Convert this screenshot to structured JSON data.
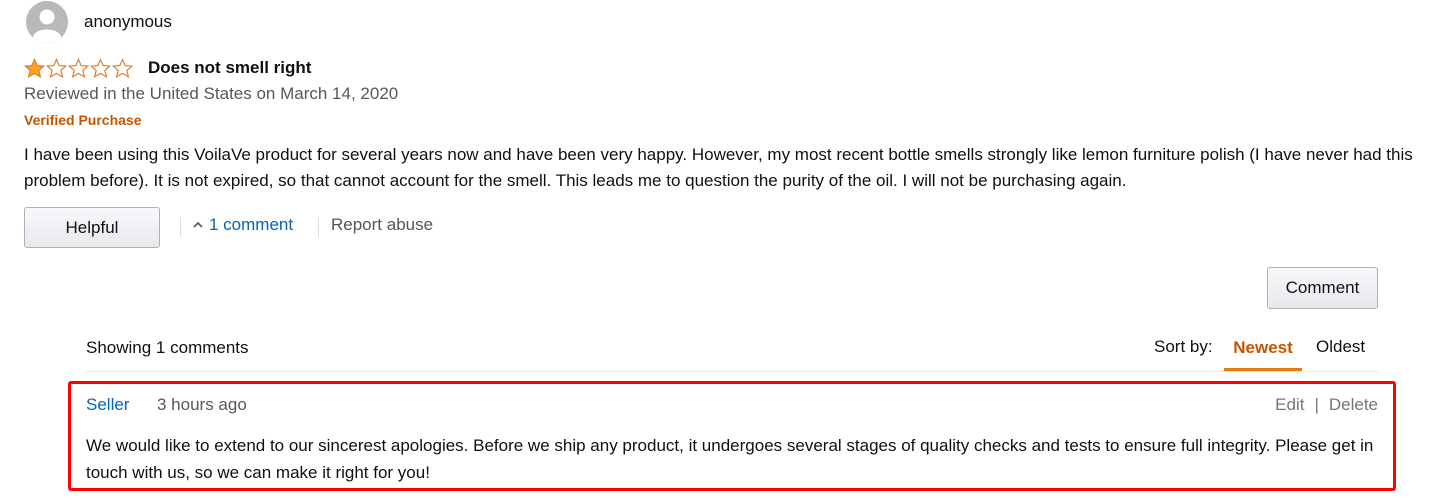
{
  "review": {
    "profile_name": "anonymous",
    "rating": 1,
    "rating_max": 5,
    "title": "Does not smell right",
    "date_line": "Reviewed in the United States on March 14, 2020",
    "verified_label": "Verified Purchase",
    "body": "I have been using this VoilaVe product for several years now and have been very happy. However, my most recent bottle smells strongly like lemon furniture polish (I have never had this problem before). It is not expired, so that cannot account for the smell. This leads me to question the purity of the oil. I will not be purchasing again."
  },
  "actions": {
    "helpful_label": "Helpful",
    "comments_link_label": "1 comment",
    "report_label": "Report abuse",
    "comment_button_label": "Comment"
  },
  "comments_section": {
    "showing_label": "Showing 1 comments",
    "sort_by_label": "Sort by:",
    "sort_options": [
      "Newest",
      "Oldest"
    ],
    "selected_sort": "Newest",
    "comments": [
      {
        "author": "Seller",
        "time": "3 hours ago",
        "edit_label": "Edit",
        "delete_label": "Delete",
        "text": "We would like to extend to our sincerest apologies. Before we ship any product, it undergoes several stages of quality checks and tests to ensure full integrity. Please get in touch with us, so we can make it right for you!"
      }
    ]
  },
  "colors": {
    "star_fill": "#ffa41c",
    "star_outline": "#de7921",
    "link": "#0066c0",
    "verified": "#c45500",
    "highlight_box": "#ff0000",
    "sort_active": "#c45500"
  },
  "icons": {
    "avatar": "default-user-avatar-icon",
    "star_filled": "star-filled-icon",
    "star_empty": "star-empty-icon",
    "caret": "caret-up-icon"
  }
}
